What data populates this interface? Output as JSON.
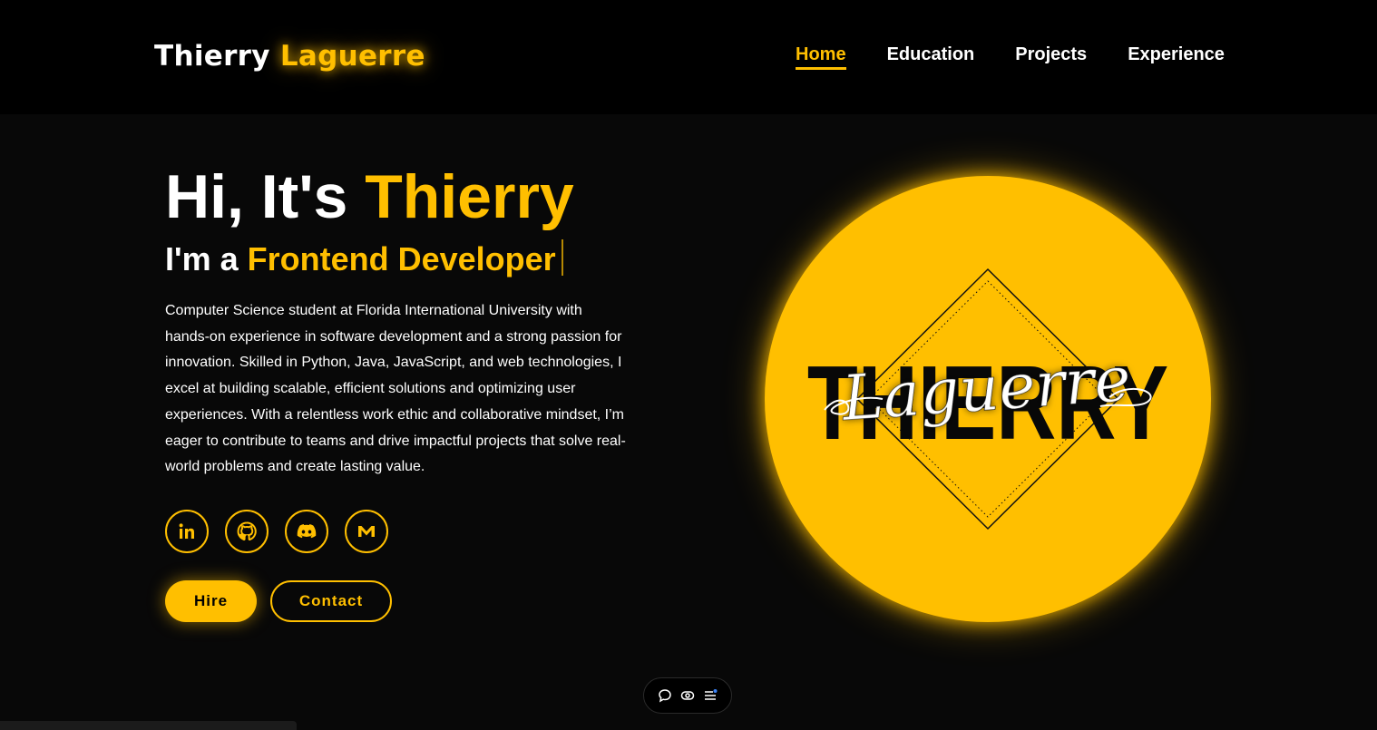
{
  "header": {
    "logo_first": "Thierry",
    "logo_last": "Laguerre",
    "nav": [
      {
        "label": "Home",
        "active": true
      },
      {
        "label": "Education",
        "active": false
      },
      {
        "label": "Projects",
        "active": false
      },
      {
        "label": "Experience",
        "active": false
      }
    ]
  },
  "hero": {
    "greeting": "Hi, It's",
    "name": "Thierry",
    "role_prefix": "I'm a",
    "role": "Frontend Developer",
    "bio": "Computer Science student at Florida International University with hands-on experience in software development and a strong passion for innovation. Skilled in Python, Java, JavaScript, and web technologies, I excel at building scalable, efficient solutions and optimizing user experiences. With a relentless work ethic and collaborative mindset, I’m eager to contribute to teams and drive impactful projects that solve real-world problems and create lasting value.",
    "socials": [
      "linkedin-icon",
      "github-icon",
      "discord-icon",
      "mail-icon"
    ],
    "buttons": {
      "hire": "Hire",
      "contact": "Contact"
    }
  },
  "avatar_logo": {
    "word": "THIERRY",
    "script": "Laguerre"
  },
  "toolbar": [
    "comment-icon",
    "eye-icon",
    "menu-icon"
  ],
  "colors": {
    "accent": "#ffbf00",
    "background": "#080808",
    "header": "#000000"
  }
}
